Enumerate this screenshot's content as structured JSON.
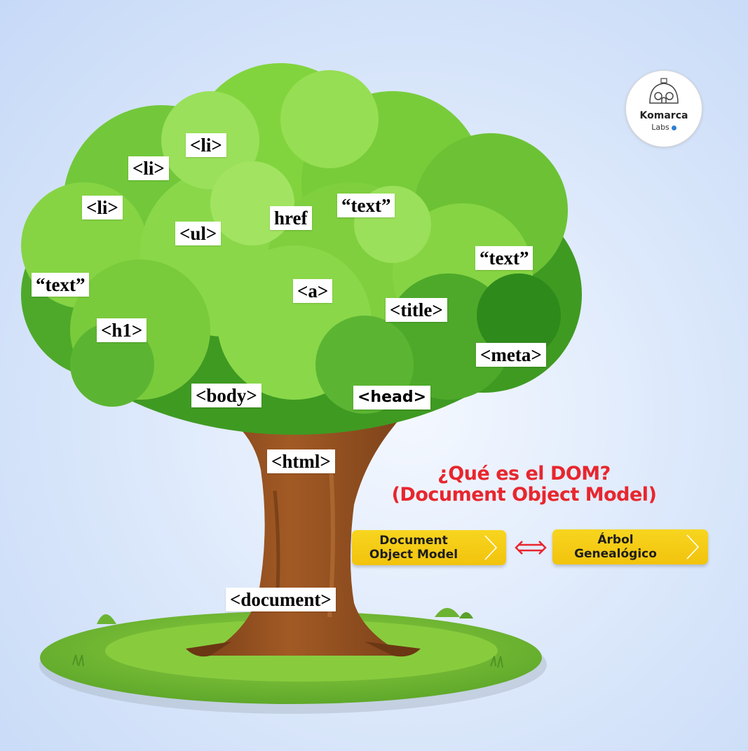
{
  "logo": {
    "name": "Komarca",
    "sub": "Labs"
  },
  "title": {
    "line1": "¿Qué es el DOM?",
    "line2": "(Document Object Model)"
  },
  "comparison": {
    "left": {
      "line1": "Document",
      "line2": "Object Model"
    },
    "right": {
      "line1": "Árbol",
      "line2": "Genealógico"
    },
    "arrow_icon": "double-arrow-icon"
  },
  "tags": {
    "li_top": "<li>",
    "li_mid": "<li>",
    "li_left": "<li>",
    "ul": "<ul>",
    "href": "href",
    "text_top": "“text”",
    "text_right": "“text”",
    "text_left": "“text”",
    "a": "<a>",
    "title": "<title>",
    "h1": "<h1>",
    "meta": "<meta>",
    "body": "<body>",
    "head": "<head>",
    "html": "<html>",
    "document": "<document>"
  },
  "colors": {
    "title_red": "#e8262e",
    "pill_yellow": "#f2c30d",
    "leaf_light": "#8fdc2f",
    "leaf_dark": "#2f8a1c",
    "trunk": "#8a4a1e",
    "grass": "#7cc33a"
  }
}
